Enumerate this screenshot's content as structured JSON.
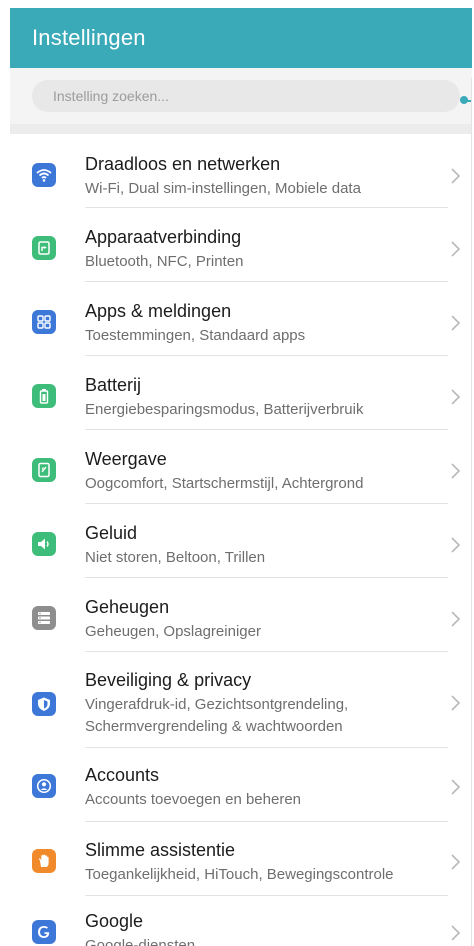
{
  "header": {
    "title": "Instellingen"
  },
  "search": {
    "placeholder": "Instelling zoeken..."
  },
  "items": [
    {
      "key": "wireless",
      "title": "Draadloos en netwerken",
      "subtitle": "Wi-Fi, Dual sim-instellingen, Mobiele data",
      "icon": "wifi-icon",
      "color": "#3d78d8"
    },
    {
      "key": "device-connection",
      "title": "Apparaatverbinding",
      "subtitle": "Bluetooth, NFC, Printen",
      "icon": "device-connection-icon",
      "color": "#3ebd7a"
    },
    {
      "key": "apps",
      "title": "Apps & meldingen",
      "subtitle": "Toestemmingen, Standaard apps",
      "icon": "apps-grid-icon",
      "color": "#3d78d8"
    },
    {
      "key": "battery",
      "title": "Batterij",
      "subtitle": "Energiebesparingsmodus, Batterijverbruik",
      "icon": "battery-icon",
      "color": "#3ebd7a"
    },
    {
      "key": "display",
      "title": "Weergave",
      "subtitle": "Oogcomfort, Startschermstijl, Achtergrond",
      "icon": "display-icon",
      "color": "#3ebd7a"
    },
    {
      "key": "sound",
      "title": "Geluid",
      "subtitle": "Niet storen, Beltoon, Trillen",
      "icon": "speaker-icon",
      "color": "#3ebd7a"
    },
    {
      "key": "storage",
      "title": "Geheugen",
      "subtitle": "Geheugen, Opslagreiniger",
      "icon": "storage-icon",
      "color": "#8e8e8e"
    },
    {
      "key": "security",
      "title": "Beveiliging & privacy",
      "subtitle": "Vingerafdruk-id, Gezichtsontgrendeling,",
      "subtitle2": "Schermvergrendeling & wachtwoorden",
      "icon": "shield-icon",
      "color": "#3d78d8"
    },
    {
      "key": "accounts",
      "title": "Accounts",
      "subtitle": "Accounts toevoegen en beheren",
      "icon": "account-icon",
      "color": "#3d78d8"
    },
    {
      "key": "assistance",
      "title": "Slimme assistentie",
      "subtitle": "Toegankelijkheid, HiTouch, Bewegingscontrole",
      "icon": "hand-icon",
      "color": "#f08a2b"
    },
    {
      "key": "google",
      "title": "Google",
      "subtitle": "Google-diensten",
      "icon": "google-icon",
      "color": "#3d78d8"
    }
  ]
}
